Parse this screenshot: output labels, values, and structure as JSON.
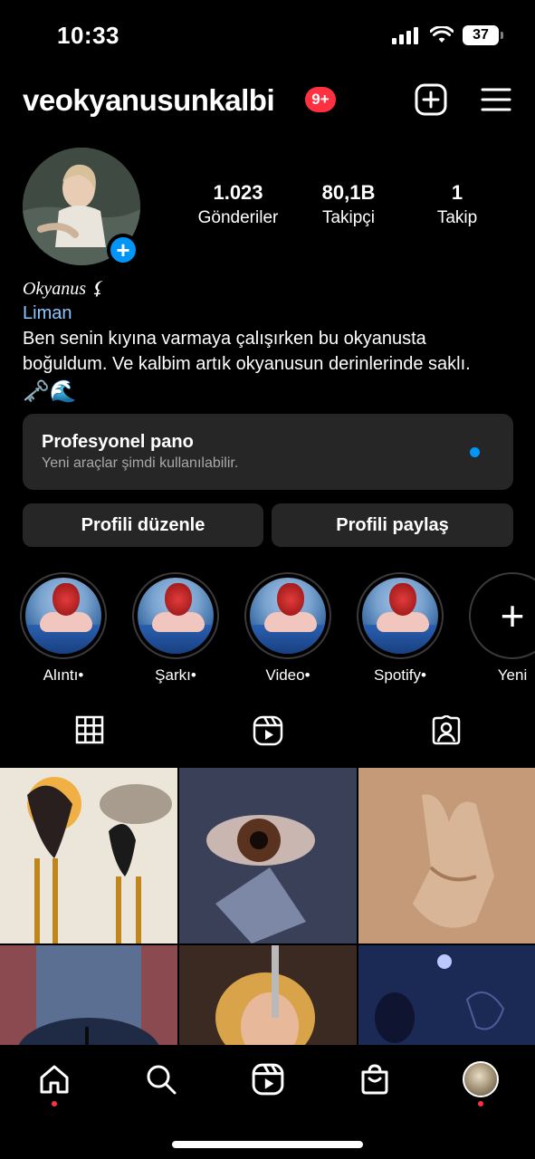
{
  "status_bar": {
    "time": "10:33",
    "battery": "37"
  },
  "header": {
    "username": "veokyanusunkalbi",
    "notification_badge": "9+"
  },
  "stats": [
    {
      "value": "1.023",
      "label": "Gönderiler"
    },
    {
      "value": "80,1B",
      "label": "Takipçi"
    },
    {
      "value": "1",
      "label": "Takip"
    }
  ],
  "bio": {
    "name": "Okyanus",
    "name_symbol": "⚸",
    "category": "Liman",
    "line1": "Ben senin kıyına varmaya çalışırken bu okyanusta",
    "line2": "boğuldum. Ve kalbim artık okyanusun derinlerinde saklı.",
    "emoji": "🗝️🌊"
  },
  "pro_panel": {
    "title": "Profesyonel pano",
    "subtitle": "Yeni araçlar şimdi kullanılabilir."
  },
  "buttons": {
    "edit_profile": "Profili düzenle",
    "share_profile": "Profili paylaş"
  },
  "highlights": [
    {
      "label": "Alıntı"
    },
    {
      "label": "Şarkı"
    },
    {
      "label": "Video"
    },
    {
      "label": "Spotify"
    }
  ],
  "highlight_new": {
    "label": "Yeni"
  },
  "colors": {
    "accent": "#0095f6",
    "badge": "#ff3040",
    "panel": "#262626",
    "background": "#000000"
  }
}
